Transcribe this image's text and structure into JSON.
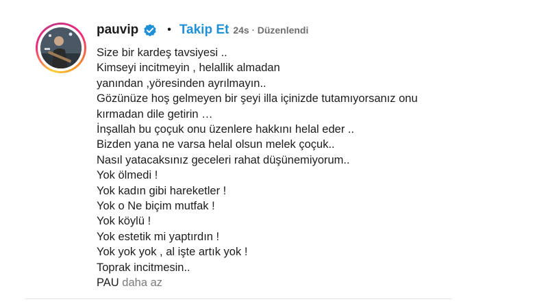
{
  "post": {
    "username": "pauvip",
    "dot": "•",
    "follow_label": "Takip Et",
    "time": "24s",
    "meta_separator": "·",
    "edited_label": "Düzenlendi",
    "caption_lines": [
      "Size bir kardeş tavsiyesi ..",
      "Kimseyi incitmeyin , helallik almadan yanından ,yöresinden ayrılmayın..",
      "Gözünüze hoş gelmeyen bir şeyi illa içinizde tutamıyorsanız onu kırmadan dile getirin …",
      "İnşallah bu çoçuk onu üzenlere hakkını helal eder ..",
      "Bizden yana ne varsa helal olsun melek çoçuk..",
      "Nasıl yatacaksınız geceleri rahat düşünemiyorum..",
      "Yok ölmedi !",
      "Yok kadın gibi hareketler !",
      "Yok o Ne biçim mutfak !",
      "Yok köylü !",
      "Yok estetik mi yaptırdın !",
      "Yok yok yok , al işte artık yok !",
      "Toprak incitmesin.."
    ],
    "signature": "PAU",
    "less_label": "daha az"
  },
  "icons": {
    "verified": "verified-badge-icon",
    "avatar": "profile-avatar"
  },
  "colors": {
    "follow": "#1f8fd6",
    "verified": "#1f8fd6",
    "muted": "#6e6e6e",
    "text": "#1c1c1c"
  }
}
